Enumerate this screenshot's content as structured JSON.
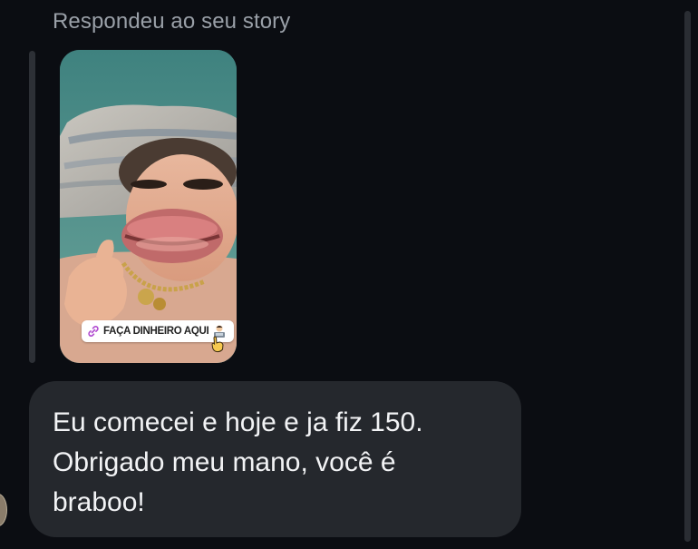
{
  "thread": {
    "reply_label": "Respondeu ao seu story",
    "story": {
      "link_sticker_text": "FAÇA DINHEIRO AQUI",
      "link_icon": "link-icon",
      "sticker_emoji": "technologist-emoji-icon",
      "pointer_emoji": "pointing-hand-icon"
    },
    "message": {
      "text": "Eu comecei e hoje e ja fiz 150.\nObrigado meu mano, você é\nbraboo!"
    }
  },
  "colors": {
    "background": "#0b0d12",
    "bubble": "#25282d",
    "label": "#9aa0a8",
    "message_text": "#f2f3f5"
  }
}
